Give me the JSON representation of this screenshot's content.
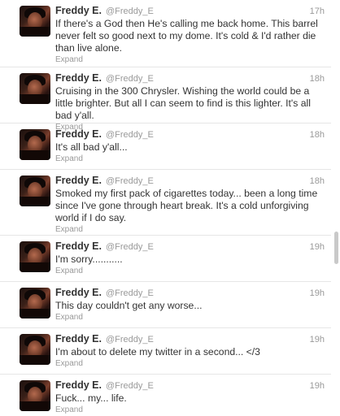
{
  "tweets": [
    {
      "fullname": "Freddy E.",
      "username": "@Freddy_E",
      "time": "17h",
      "text": "If there's a God then He's calling me back home. This barrel never felt so good next to my dome. It's cold & I'd rather die than live alone.",
      "expand": "Expand"
    },
    {
      "fullname": "Freddy E.",
      "username": "@Freddy_E",
      "time": "18h",
      "text": "Cruising in the 300 Chrysler. Wishing the world could be a little brighter. But all I can seem to find is this lighter. It's all bad y'all.",
      "expand": "Expand"
    },
    {
      "fullname": "Freddy E.",
      "username": "@Freddy_E",
      "time": "18h",
      "text": "It's all bad y'all...",
      "expand": "Expand"
    },
    {
      "fullname": "Freddy E.",
      "username": "@Freddy_E",
      "time": "18h",
      "text": "Smoked my first pack of cigarettes today... been a long time since I've gone through heart break. It's a cold unforgiving world if I do say.",
      "expand": "Expand"
    },
    {
      "fullname": "Freddy E.",
      "username": "@Freddy_E",
      "time": "19h",
      "text": "I'm sorry...........",
      "expand": "Expand"
    },
    {
      "fullname": "Freddy E.",
      "username": "@Freddy_E",
      "time": "19h",
      "text": "This day couldn't get any worse...",
      "expand": "Expand"
    },
    {
      "fullname": "Freddy E.",
      "username": "@Freddy_E",
      "time": "19h",
      "text": "I'm about to delete my twitter in a second... </3",
      "expand": "Expand"
    },
    {
      "fullname": "Freddy E.",
      "username": "@Freddy_E",
      "time": "19h",
      "text": "Fuck... my... life.",
      "expand": "Expand"
    }
  ]
}
